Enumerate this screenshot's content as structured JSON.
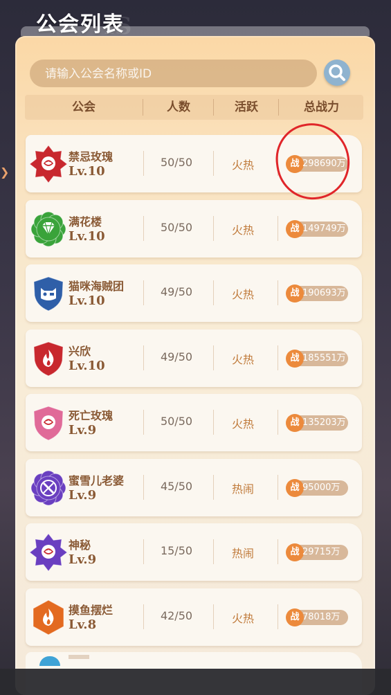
{
  "page": {
    "title": "公会列表",
    "bg_ghost_text": "IS"
  },
  "search": {
    "placeholder": "请输入公会名称或ID"
  },
  "columns": [
    "公会",
    "人数",
    "活跃",
    "总战力"
  ],
  "power_badge_label": "战",
  "guilds": [
    {
      "name": "禁忌玫瑰",
      "level": "Lv.10",
      "members": "50/50",
      "activity": "火热",
      "power": "298690万",
      "emblem_color": "#c8282e",
      "emblem_shape": "star",
      "emblem_icon": "rose-icon"
    },
    {
      "name": "满花楼",
      "level": "Lv.10",
      "members": "50/50",
      "activity": "火热",
      "power": "149749万",
      "emblem_color": "#3aa33a",
      "emblem_shape": "flower",
      "emblem_icon": "diamond-icon"
    },
    {
      "name": "猫咪海贼团",
      "level": "Lv.10",
      "members": "49/50",
      "activity": "火热",
      "power": "190693万",
      "emblem_color": "#2f5fa8",
      "emblem_shape": "shield",
      "emblem_icon": "cat-icon"
    },
    {
      "name": "兴欣",
      "level": "Lv.10",
      "members": "49/50",
      "activity": "火热",
      "power": "185551万",
      "emblem_color": "#c8282e",
      "emblem_shape": "shield",
      "emblem_icon": "flame-icon"
    },
    {
      "name": "死亡玫瑰",
      "level": "Lv.9",
      "members": "50/50",
      "activity": "火热",
      "power": "135203万",
      "emblem_color": "#e06a98",
      "emblem_shape": "shield",
      "emblem_icon": "rose-icon"
    },
    {
      "name": "蜜雪儿老婆",
      "level": "Lv.9",
      "members": "45/50",
      "activity": "热闹",
      "power": "95000万",
      "emblem_color": "#6a3fc0",
      "emblem_shape": "flower",
      "emblem_icon": "sword-icon"
    },
    {
      "name": "神秘",
      "level": "Lv.9",
      "members": "15/50",
      "activity": "热闹",
      "power": "29715万",
      "emblem_color": "#6a3fc0",
      "emblem_shape": "star",
      "emblem_icon": "rose-icon"
    },
    {
      "name": "摸鱼摆烂",
      "level": "Lv.8",
      "members": "42/50",
      "activity": "火热",
      "power": "78018万",
      "emblem_color": "#e36a20",
      "emblem_shape": "hexagon",
      "emblem_icon": "flame-icon"
    }
  ]
}
